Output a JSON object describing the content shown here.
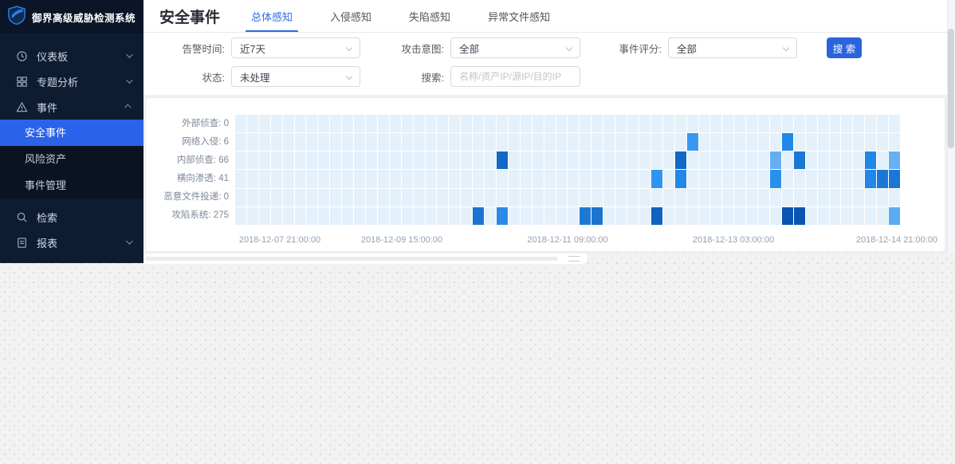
{
  "app": {
    "accent_color": "#2f6ce5",
    "button_color": "#2b63dd",
    "sidebar_active_color": "#2a63e9"
  },
  "sidebar": {
    "logo_title": "御界高级威胁检测系统",
    "items": [
      {
        "label": "仪表板",
        "icon": "dashboard-icon",
        "chevron": "down"
      },
      {
        "label": "专题分析",
        "icon": "grid-icon",
        "chevron": "down"
      },
      {
        "label": "事件",
        "icon": "warning-icon",
        "chevron": "up"
      },
      {
        "label": "检索",
        "icon": "search-icon",
        "chevron": ""
      },
      {
        "label": "报表",
        "icon": "report-icon",
        "chevron": "down"
      }
    ],
    "submenu": [
      {
        "label": "安全事件",
        "active": true
      },
      {
        "label": "风险资产",
        "active": false
      },
      {
        "label": "事件管理",
        "active": false
      }
    ]
  },
  "header": {
    "page_title": "安全事件",
    "tabs": [
      {
        "label": "总体感知",
        "active": true
      },
      {
        "label": "入侵感知",
        "active": false
      },
      {
        "label": "失陷感知",
        "active": false
      },
      {
        "label": "异常文件感知",
        "active": false
      }
    ]
  },
  "filters": {
    "alert_time": {
      "label": "告警时间:",
      "value": "近7天"
    },
    "attack_intent": {
      "label": "攻击意图:",
      "value": "全部"
    },
    "event_score": {
      "label": "事件评分:",
      "value": "全部"
    },
    "status": {
      "label": "状态:",
      "value": "未处理"
    },
    "search": {
      "label": "搜索:",
      "placeholder": "名称/资产IP/源IP/目的IP"
    },
    "search_button": "搜 索"
  },
  "chart_data": {
    "type": "heatmap",
    "title": "",
    "rows": [
      {
        "label": "外部侦查",
        "count": 0
      },
      {
        "label": "网络入侵",
        "count": 6
      },
      {
        "label": "内部侦查",
        "count": 66
      },
      {
        "label": "横向渗透",
        "count": 41
      },
      {
        "label": "恶意文件投递",
        "count": 0
      },
      {
        "label": "攻陷系统",
        "count": 275
      }
    ],
    "x_axis": {
      "columns": 56,
      "cell_hours": 3,
      "start": "2018-12-07 21:00:00",
      "end": "2018-12-14 21:00:00",
      "tick_labels": [
        "2018-12-07 21:00:00",
        "2018-12-09 15:00:00",
        "2018-12-11 09:00:00",
        "2018-12-13 03:00:00",
        "2018-12-14 21:00:00"
      ]
    },
    "grid": true,
    "base_cell_color": "#e4f1fb",
    "highlighted_cells": [
      {
        "row": "内部侦查",
        "col": 22,
        "color": "#1368c6"
      },
      {
        "row": "攻陷系统",
        "col": 20,
        "color": "#1b74d1"
      },
      {
        "row": "攻陷系统",
        "col": 22,
        "color": "#2b8ae8"
      },
      {
        "row": "攻陷系统",
        "col": 29,
        "color": "#1d7ad4"
      },
      {
        "row": "攻陷系统",
        "col": 30,
        "color": "#1a74d0"
      },
      {
        "row": "横向渗透",
        "col": 35,
        "color": "#2e94f3"
      },
      {
        "row": "攻陷系统",
        "col": 35,
        "color": "#0f62c0"
      },
      {
        "row": "内部侦查",
        "col": 37,
        "color": "#1368c6"
      },
      {
        "row": "横向渗透",
        "col": 37,
        "color": "#2187e8"
      },
      {
        "row": "网络入侵",
        "col": 38,
        "color": "#3a97ef"
      },
      {
        "row": "内部侦查",
        "col": 45,
        "color": "#66aef2"
      },
      {
        "row": "横向渗透",
        "col": 45,
        "color": "#2a90ec"
      },
      {
        "row": "网络入侵",
        "col": 46,
        "color": "#2088e8"
      },
      {
        "row": "攻陷系统",
        "col": 46,
        "color": "#0a55b2"
      },
      {
        "row": "内部侦查",
        "col": 47,
        "color": "#1b76d4"
      },
      {
        "row": "攻陷系统",
        "col": 47,
        "color": "#0a55b2"
      },
      {
        "row": "内部侦查",
        "col": 53,
        "color": "#2285e8"
      },
      {
        "row": "横向渗透",
        "col": 53,
        "color": "#2285e8"
      },
      {
        "row": "横向渗透",
        "col": 54,
        "color": "#1a77d8"
      },
      {
        "row": "内部侦查",
        "col": 55,
        "color": "#66b0f4"
      },
      {
        "row": "横向渗透",
        "col": 55,
        "color": "#1a77d8"
      },
      {
        "row": "攻陷系统",
        "col": 55,
        "color": "#5aabf2"
      }
    ]
  }
}
